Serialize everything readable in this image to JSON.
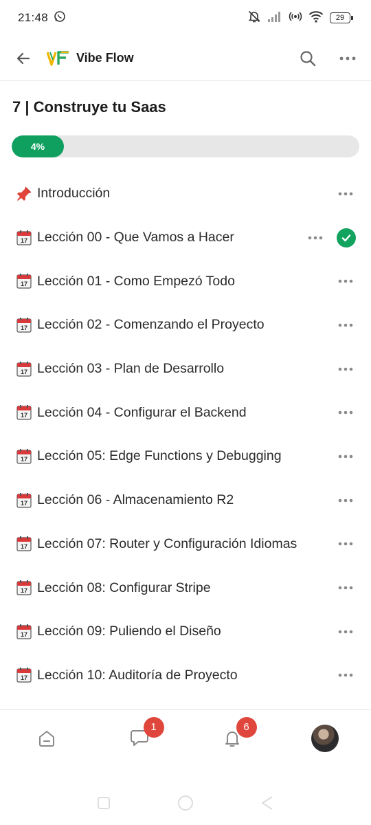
{
  "status": {
    "time": "21:48",
    "battery": "29"
  },
  "header": {
    "title": "Vibe Flow"
  },
  "course": {
    "title": "7 | Construye tu Saas",
    "progress_label": "4%",
    "progress_fraction": 0.04
  },
  "lessons": [
    {
      "icon": "pushpin-icon",
      "label": "Introducción"
    },
    {
      "icon": "calendar-icon",
      "label": "Lección 00 - Que Vamos a Hacer"
    },
    {
      "icon": "calendar-icon",
      "label": "Lección 01 - Como Empezó Todo"
    },
    {
      "icon": "calendar-icon",
      "label": "Lección 02 - Comenzando el Proyecto"
    },
    {
      "icon": "calendar-icon",
      "label": "Lección 03 - Plan de Desarrollo"
    },
    {
      "icon": "calendar-icon",
      "label": "Lección 04 - Configurar el Backend"
    },
    {
      "icon": "calendar-icon",
      "label": "Lección 05: Edge Functions y Debugging"
    },
    {
      "icon": "calendar-icon",
      "label": "Lección 06 - Almacenamiento R2"
    },
    {
      "icon": "calendar-icon",
      "label": "Lección 07: Router y Configuración Idiomas"
    },
    {
      "icon": "calendar-icon",
      "label": "Lección 08: Configurar Stripe"
    },
    {
      "icon": "calendar-icon",
      "label": "Lección 09: Puliendo el Diseño"
    },
    {
      "icon": "calendar-icon",
      "label": "Lección 10: Auditoría de Proyecto"
    }
  ],
  "nav": {
    "messages_badge": "1",
    "notifications_badge": "6"
  },
  "colors": {
    "accent": "#0fa060",
    "badge": "#e0473c"
  }
}
